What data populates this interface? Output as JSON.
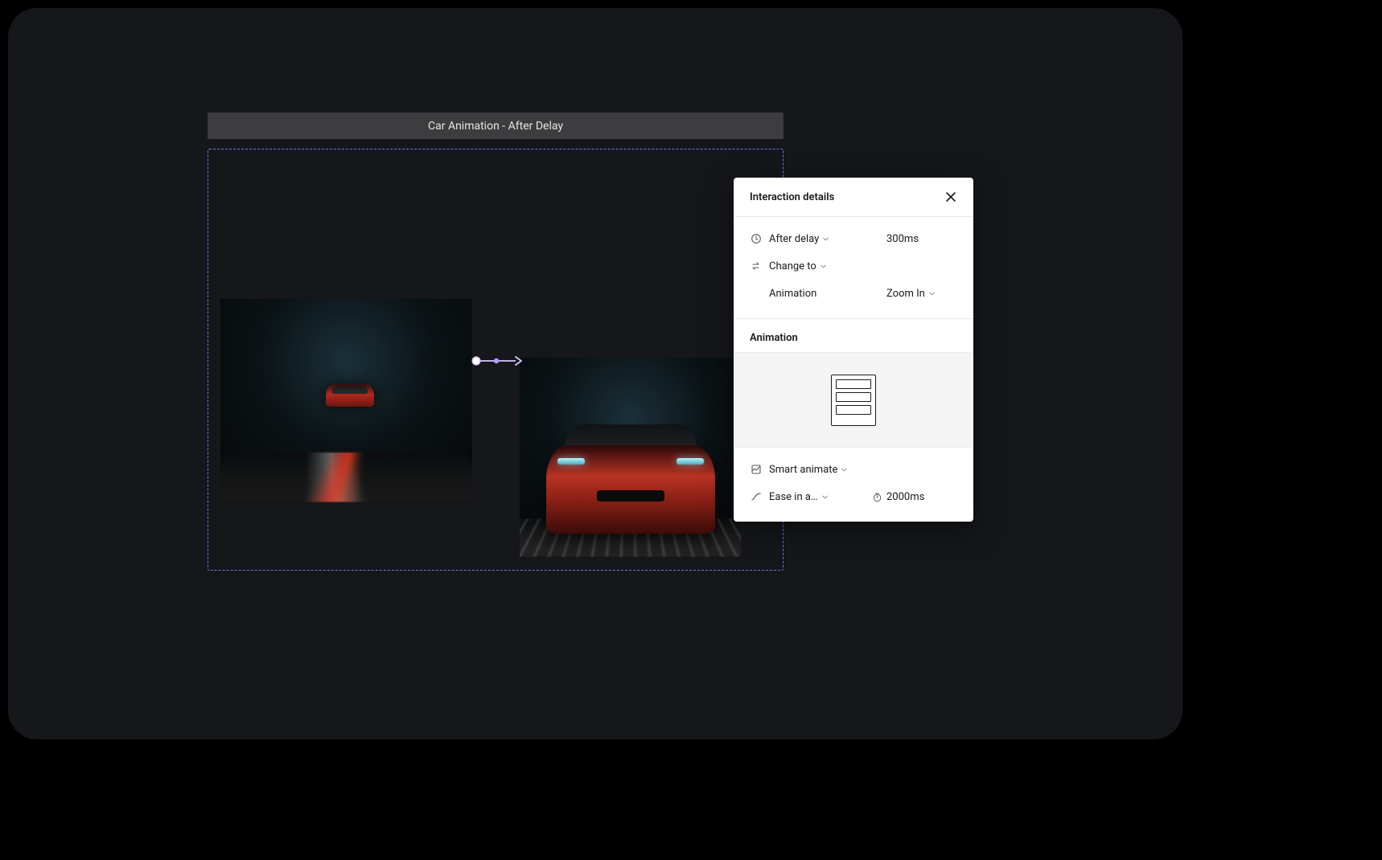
{
  "canvas": {
    "frame_title": "Car Animation - After Delay"
  },
  "panel": {
    "title": "Interaction details",
    "trigger": {
      "label": "After delay",
      "value": "300ms"
    },
    "action": {
      "label": "Change to"
    },
    "destination": {
      "label": "Animation",
      "value": "Zoom In"
    },
    "animation_section_title": "Animation",
    "animation": {
      "type_label": "Smart animate",
      "easing_label": "Ease in a…",
      "duration_value": "2000ms"
    }
  }
}
